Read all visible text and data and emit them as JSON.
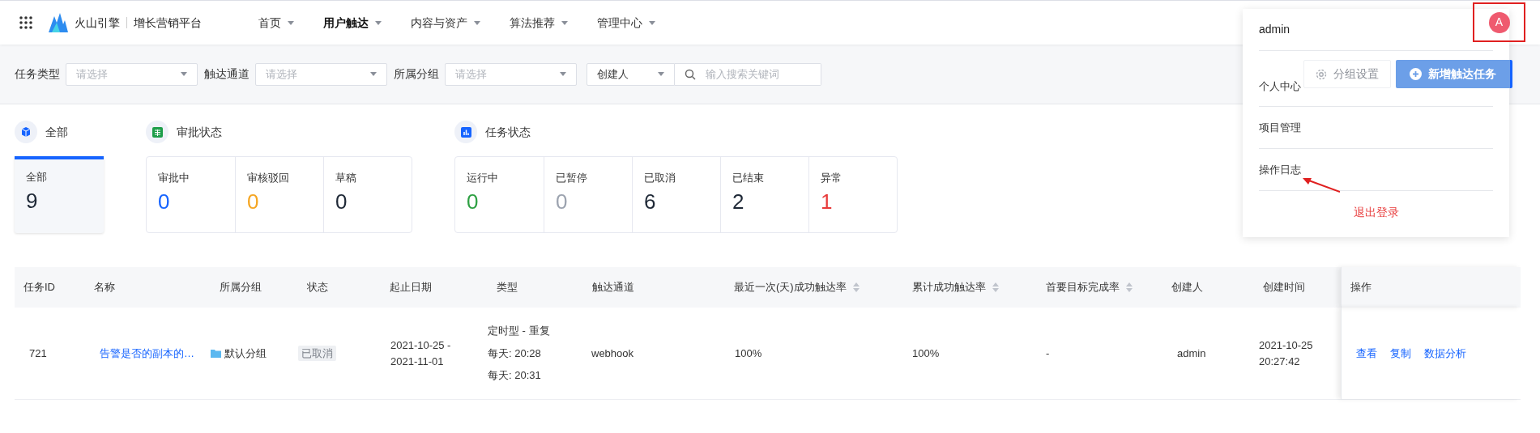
{
  "brand": {
    "name": "火山引擎",
    "product": "增长营销平台"
  },
  "nav": [
    {
      "label": "首页",
      "selected": false
    },
    {
      "label": "用户触达",
      "selected": true
    },
    {
      "label": "内容与资产",
      "selected": false
    },
    {
      "label": "算法推荐",
      "selected": false
    },
    {
      "label": "管理中心",
      "selected": false
    }
  ],
  "filters": [
    {
      "label": "任务类型",
      "placeholder": "请选择"
    },
    {
      "label": "触达通道",
      "placeholder": "请选择"
    },
    {
      "label": "所属分组",
      "placeholder": "请选择"
    }
  ],
  "search": {
    "field_select": "创建人",
    "placeholder": "输入搜索关键词"
  },
  "actions": [
    {
      "label": "分组设置",
      "kind": "secondary",
      "disabled": true
    },
    {
      "label": "新增触达任务",
      "kind": "primary",
      "disabled": true
    }
  ],
  "stat_groups": [
    {
      "title": "全部",
      "kind": "all",
      "items": [
        {
          "label": "全部",
          "value": "9",
          "color": "#1f2937",
          "selected": true
        }
      ]
    },
    {
      "title": "审批状态",
      "kind": "approval",
      "items": [
        {
          "label": "审批中",
          "value": "0",
          "color": "#1664ff"
        },
        {
          "label": "审核驳回",
          "value": "0",
          "color": "#f5a623"
        },
        {
          "label": "草稿",
          "value": "0",
          "color": "#1f2937"
        }
      ]
    },
    {
      "title": "任务状态",
      "kind": "task",
      "items": [
        {
          "label": "运行中",
          "value": "0",
          "color": "#2ea043"
        },
        {
          "label": "已暂停",
          "value": "0",
          "color": "#9ca3af"
        },
        {
          "label": "已取消",
          "value": "6",
          "color": "#1f2937"
        },
        {
          "label": "已结束",
          "value": "2",
          "color": "#1f2937"
        },
        {
          "label": "异常",
          "value": "1",
          "color": "#e83b3b"
        }
      ]
    }
  ],
  "table": {
    "columns": [
      {
        "label": "任务ID",
        "sortable": false
      },
      {
        "label": "名称",
        "sortable": false
      },
      {
        "label": "所属分组",
        "sortable": false
      },
      {
        "label": "状态",
        "sortable": false
      },
      {
        "label": "起止日期",
        "sortable": false
      },
      {
        "label": "类型",
        "sortable": false
      },
      {
        "label": "触达通道",
        "sortable": false
      },
      {
        "label": "最近一次(天)成功触达率",
        "sortable": true
      },
      {
        "label": "累计成功触达率",
        "sortable": true
      },
      {
        "label": "首要目标完成率",
        "sortable": true
      },
      {
        "label": "创建人",
        "sortable": false
      },
      {
        "label": "创建时间",
        "sortable": false
      },
      {
        "label": "操作",
        "sortable": false
      }
    ],
    "rows": [
      {
        "id": "721",
        "name": "告警是否的副本的…",
        "group": "默认分组",
        "status": "已取消",
        "dates": "2021-10-25 - 2021-11-01",
        "type_lines": [
          "定时型 - 重复",
          "每天: 20:28",
          "每天: 20:31"
        ],
        "channel": "webhook",
        "recent_rate": "100%",
        "total_rate": "100%",
        "goal_rate": "-",
        "creator": "admin",
        "created": "2021-10-25 20:27:42",
        "ops": [
          "查看",
          "复制",
          "数据分析"
        ]
      }
    ]
  },
  "user_menu": {
    "avatar": "A",
    "username": "admin",
    "items": [
      "个人中心",
      "项目管理",
      "操作日志"
    ],
    "logout": "退出登录"
  }
}
